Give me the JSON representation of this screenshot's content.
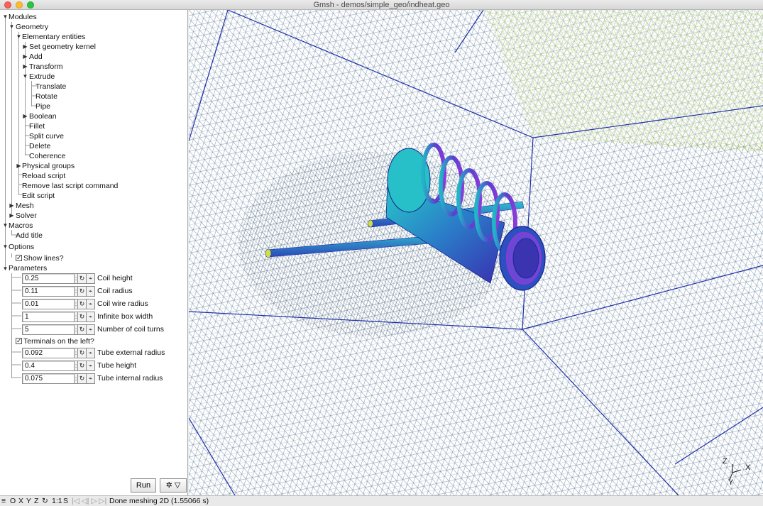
{
  "window": {
    "title": "Gmsh - demos/simple_geo/indheat.geo"
  },
  "tree": {
    "modules": "Modules",
    "geometry": "Geometry",
    "elementary": "Elementary entities",
    "set_kernel": "Set geometry kernel",
    "add": "Add",
    "transform": "Transform",
    "extrude": "Extrude",
    "translate": "Translate",
    "rotate": "Rotate",
    "pipe": "Pipe",
    "boolean": "Boolean",
    "fillet": "Fillet",
    "split_curve": "Split curve",
    "delete": "Delete",
    "coherence": "Coherence",
    "physical_groups": "Physical groups",
    "reload_script": "Reload script",
    "remove_last": "Remove last script command",
    "edit_script": "Edit script",
    "mesh": "Mesh",
    "solver": "Solver",
    "macros": "Macros",
    "add_title": "Add title",
    "options": "Options",
    "show_lines": "Show lines?",
    "parameters": "Parameters"
  },
  "parameters": [
    {
      "value": "0.25",
      "label": "Coil height"
    },
    {
      "value": "0.11",
      "label": "Coil radius"
    },
    {
      "value": "0.01",
      "label": "Coil wire radius"
    },
    {
      "value": "1",
      "label": "Infinite box width"
    },
    {
      "value": "5",
      "label": "Number of coil turns"
    },
    {
      "value": "0.092",
      "label": "Tube external radius"
    },
    {
      "value": "0.4",
      "label": "Tube height"
    },
    {
      "value": "0.075",
      "label": "Tube internal radius"
    }
  ],
  "terminals_label": "Terminals on the left?",
  "checked": {
    "show_lines": true,
    "terminals": true
  },
  "buttons": {
    "run": "Run",
    "gear": "✲ ▽"
  },
  "param_buttons": {
    "menu": ":",
    "loop": "↻",
    "graph": "⌁"
  },
  "axes": {
    "z": "Z",
    "x": "X",
    "y": "Y"
  },
  "statusbar": {
    "menu_icon": "≡",
    "o": "O",
    "x": "X",
    "y": "Y",
    "z": "Z",
    "rotate_icon": "↻",
    "scale": "1:1",
    "s": "S",
    "nav": "|◁ ◁| ▷ ▷|",
    "message": "Done meshing 2D (1.55066 s)"
  },
  "colors": {
    "mesh_blue": "#1f2fa8",
    "mesh_green": "#8fbf3a",
    "coil_cyan": "#20b8c8",
    "coil_purple": "#8a3bd8"
  }
}
